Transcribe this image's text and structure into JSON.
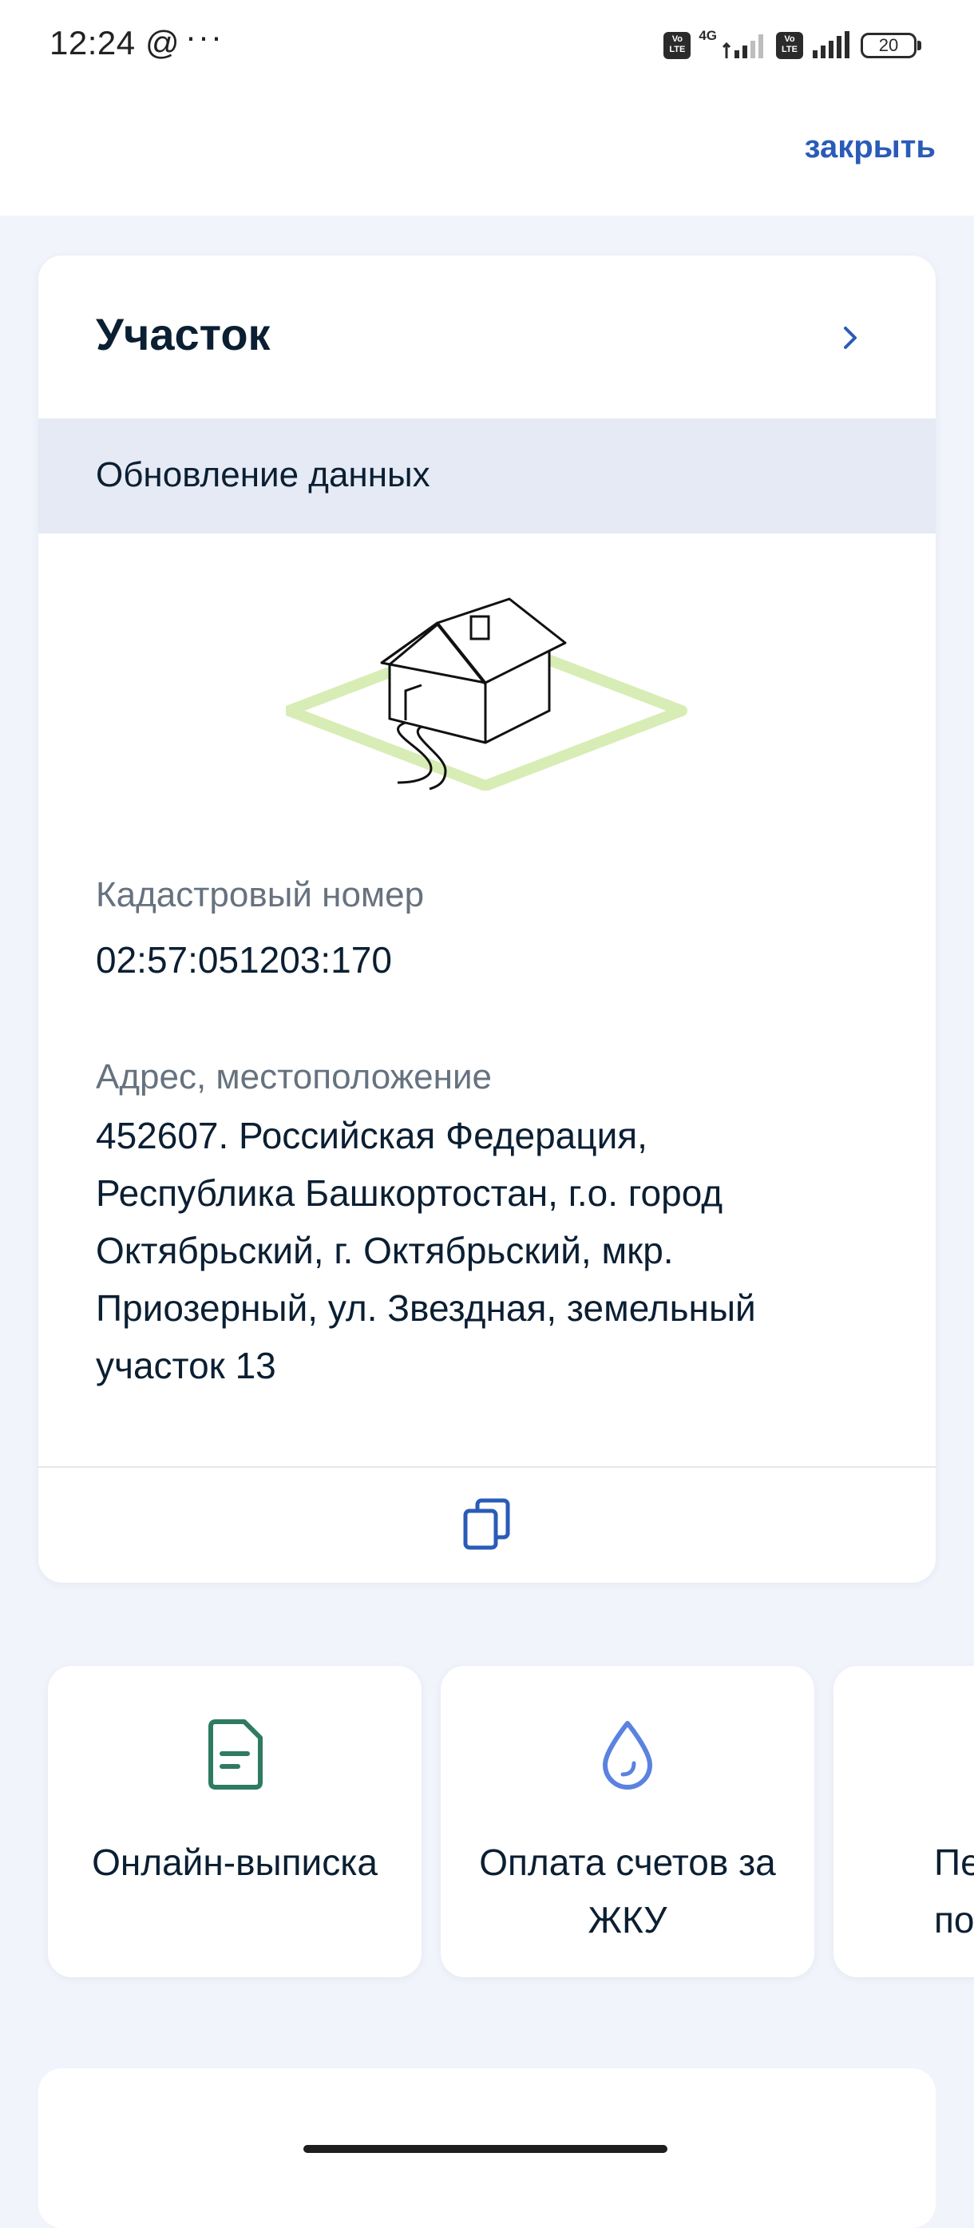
{
  "status_bar": {
    "time": "12:24",
    "at_symbol": "@",
    "more_dots": "···",
    "volte_label": "Vo\nLTE",
    "network_type": "4G",
    "battery_level": "20"
  },
  "header": {
    "close_label": "закрыть"
  },
  "card": {
    "title": "Участок",
    "update_banner": "Обновление данных",
    "cadastral_label": "Кадастровый номер",
    "cadastral_value": "02:57:051203:170",
    "address_label": "Адрес, местоположение",
    "address_lines": [
      "452607. Российская Федерация,",
      "Республика Башкортостан, г.о. город",
      "Октябрьский, г. Октябрьский, мкр.",
      "Приозерный, ул. Звездная, земельный",
      "участок 13"
    ]
  },
  "tiles": [
    {
      "label_lines": [
        "Онлайн-выписка"
      ],
      "icon": "document-icon",
      "icon_color": "#2f7a63"
    },
    {
      "label_lines": [
        "Оплата счетов за",
        "ЖКУ"
      ],
      "icon": "water-drop-icon",
      "icon_color": "#5b82e0"
    },
    {
      "label_lines": [
        "Пе",
        "по"
      ],
      "icon": "none"
    }
  ],
  "colors": {
    "accent": "#2a5bb8",
    "background": "#f1f4fb",
    "banner": "#e5eaf5",
    "plot_green": "#d8edb5"
  }
}
